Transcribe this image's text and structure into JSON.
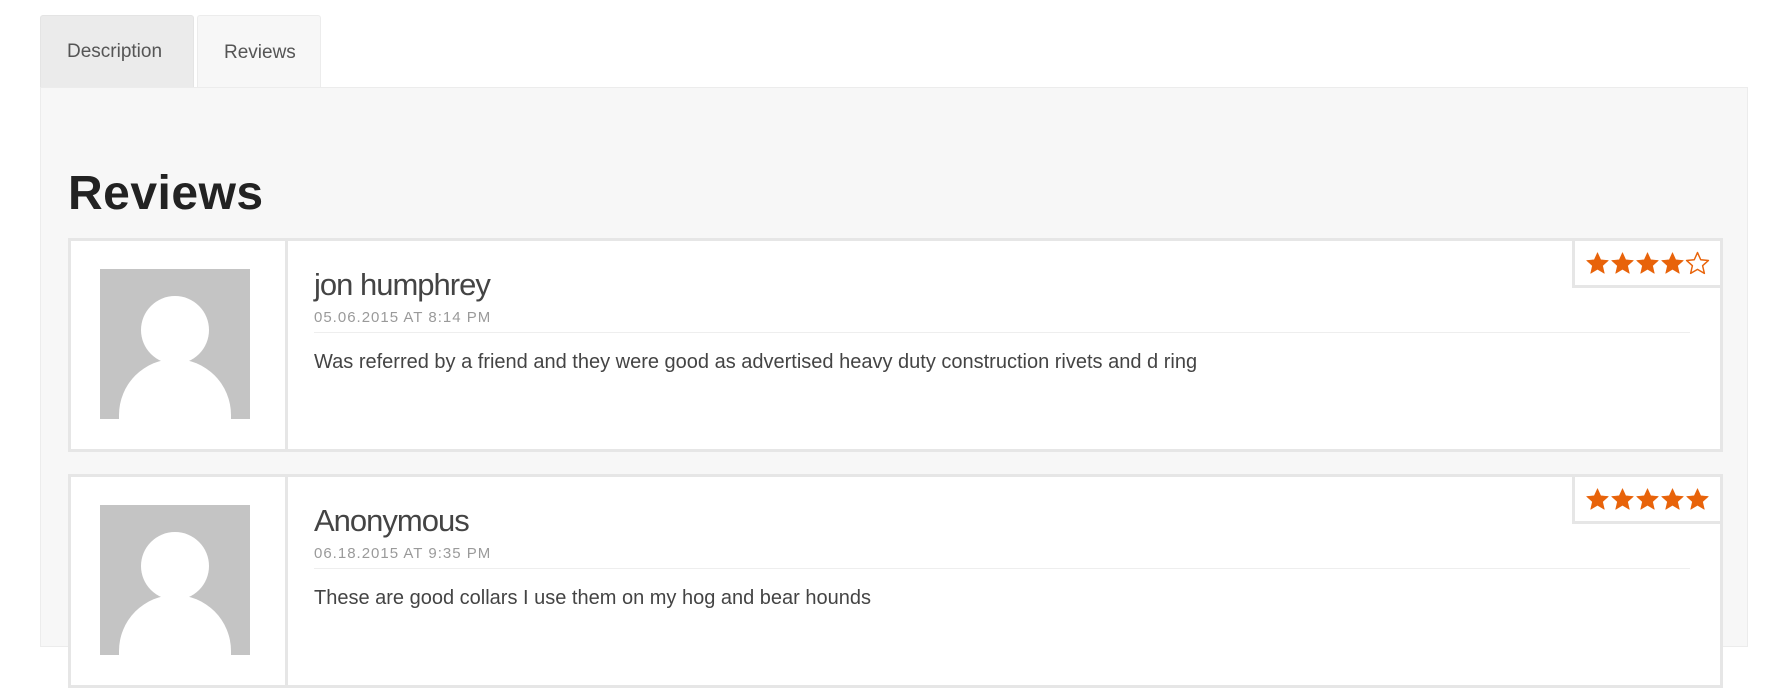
{
  "tabs": [
    {
      "label": "Description",
      "active": false
    },
    {
      "label": "Reviews",
      "active": true
    }
  ],
  "reviews_section": {
    "title": "Reviews",
    "star_color": "#e8630a",
    "items": [
      {
        "author": "jon humphrey",
        "date": "05.06.2015 AT 8:14 PM",
        "text": "Was referred by a friend and they were good as advertised heavy duty construction rivets and d ring",
        "rating": 4,
        "rating_max": 5
      },
      {
        "author": "Anonymous",
        "date": "06.18.2015 AT 9:35 PM",
        "text": "These are good collars I use them on my hog and bear hounds",
        "rating": 5,
        "rating_max": 5
      }
    ]
  }
}
